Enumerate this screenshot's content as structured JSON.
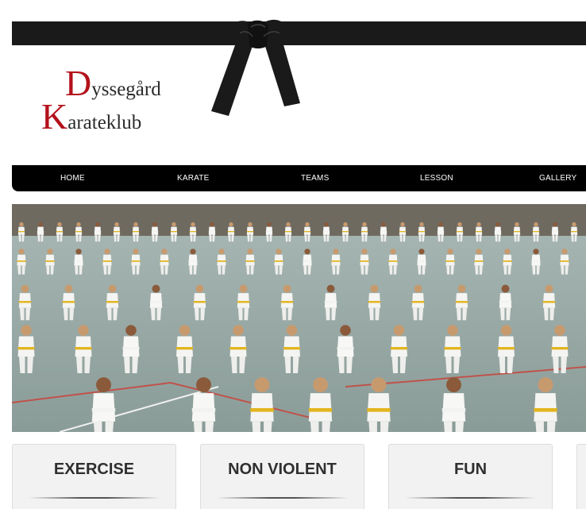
{
  "logo": {
    "line1_initial": "D",
    "line1_rest": "yssegård",
    "line2_initial": "K",
    "line2_rest": "arateklub",
    "accent_color": "#b3121b"
  },
  "nav": {
    "items": [
      {
        "label": "HOME"
      },
      {
        "label": "KARATE"
      },
      {
        "label": "TEAMS"
      },
      {
        "label": "LESSON"
      },
      {
        "label": "GALLERY"
      }
    ]
  },
  "features": [
    {
      "title": "EXERCISE"
    },
    {
      "title": "NON VIOLENT"
    },
    {
      "title": "FUN"
    },
    {
      "title": ""
    }
  ],
  "icons": {
    "belt": "black-belt-icon"
  }
}
